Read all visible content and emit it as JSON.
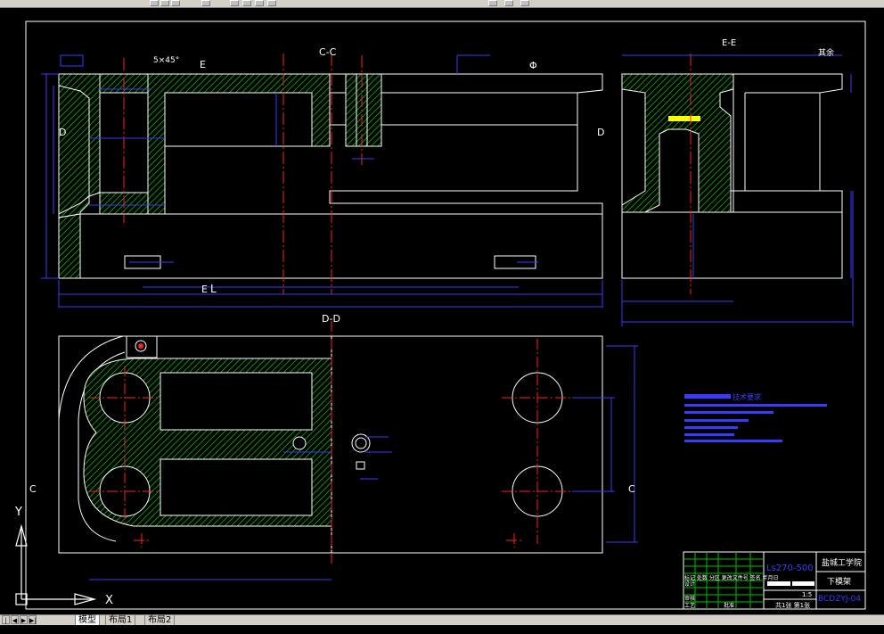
{
  "tabs": [
    {
      "label": "模型"
    },
    {
      "label": "布局1"
    },
    {
      "label": "布局2"
    }
  ],
  "nav_buttons": [
    "|◀",
    "◀",
    "▶",
    "▶|"
  ],
  "ucs": {
    "x_label": "X",
    "y_label": "Y"
  },
  "views": {
    "section_cc": "C-C",
    "section_ee": "E-E",
    "section_dd": "D-D",
    "mark_e_left": "E",
    "mark_e_right": "E",
    "mark_d_left": "D",
    "mark_d_right": "D",
    "mark_c_left": "C",
    "mark_c_right": "C",
    "chamfer_note": "5×45°",
    "roughness_main": "Φ",
    "roughness_ee": "其余"
  },
  "tech": {
    "heading": "技术要求"
  },
  "title_block": {
    "school": "盐城工学院",
    "part_name": "下模架",
    "drawing_no": "Ls270-500",
    "code": "BCDZYJ-04",
    "scale": "1:5",
    "sheet": "共1张 第1张",
    "rows": [
      "标记 处数 分区 更改文件号 签名 年月日",
      "设计",
      "审核",
      "工艺"
    ],
    "batch": "批准"
  },
  "colors": {
    "bg": "#000000",
    "outline": "#ffffff",
    "hatch": "#00c000",
    "dim": "#3a3aff",
    "center": "#ff2020",
    "highlight": "#ffff00"
  }
}
